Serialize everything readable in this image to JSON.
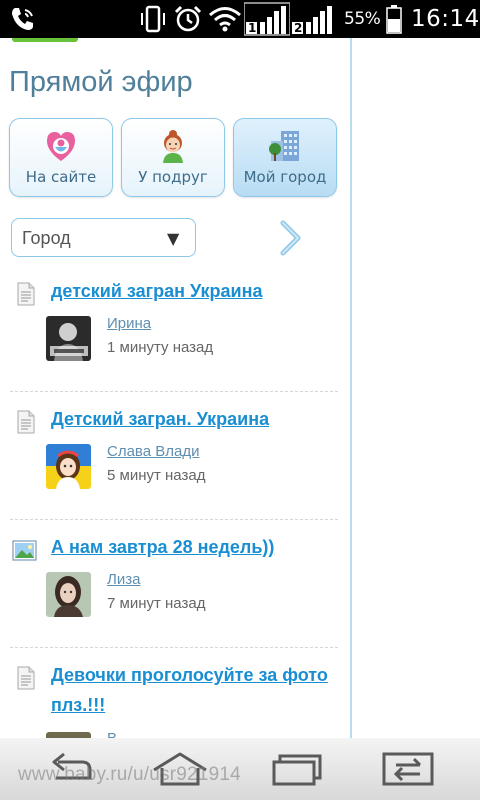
{
  "status_bar": {
    "battery": "55%",
    "time": "16:14"
  },
  "page": {
    "title": "Прямой эфир",
    "filters": [
      {
        "label": "На сайте",
        "icon": "babyru-logo-icon",
        "active": false
      },
      {
        "label": "У подруг",
        "icon": "girl-avatar-icon",
        "active": false
      },
      {
        "label": "Мой город",
        "icon": "city-buildings-icon",
        "active": true
      }
    ],
    "city_select": {
      "value": "Город"
    },
    "feed": [
      {
        "title": "детский загран Украина",
        "icon": "document-icon",
        "author": "Ирина",
        "time_ago": "1 минуту назад"
      },
      {
        "title": "Детский загран. Украина",
        "icon": "document-icon",
        "author": "Слава Влади",
        "time_ago": "5 минут назад"
      },
      {
        "title": "А нам завтра 28 недель))",
        "icon": "photo-icon",
        "author": "Лиза",
        "time_ago": "7 минут назад"
      },
      {
        "title": "Девочки проголосуйте за фото плз.!!!",
        "icon": "document-icon",
        "author": "В",
        "time_ago": ""
      }
    ]
  },
  "browser": {
    "url": "www.baby.ru/u/usr921914"
  }
}
